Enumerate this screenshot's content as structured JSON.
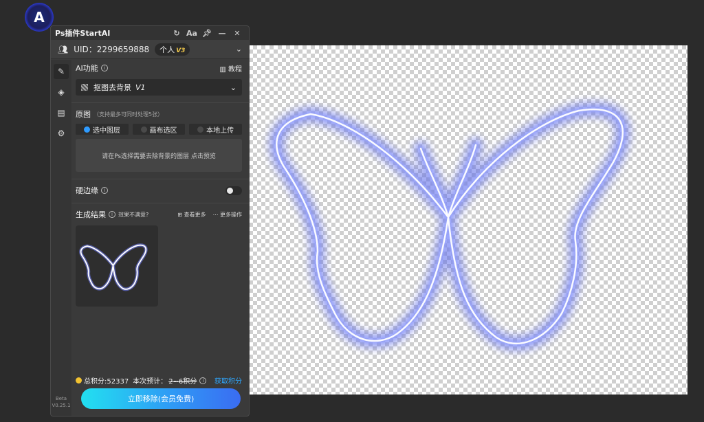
{
  "window": {
    "title": "Ps插件StartAI",
    "icons": [
      "refresh-icon",
      "font-size-icon",
      "pin-icon",
      "minimize-icon",
      "close-icon"
    ],
    "font_size_label": "Aa"
  },
  "user": {
    "uid": "UID：2299659888",
    "plan": "个人",
    "plan_version": "V3"
  },
  "sidebar": {
    "items": [
      "pen-icon",
      "layers-icon",
      "save-icon",
      "gear-icon"
    ],
    "beta": "Beta",
    "version": "V0.25.1"
  },
  "ai": {
    "label": "AI功能",
    "tutorial": "教程",
    "selected": "抠图去背景",
    "selected_version": "V1"
  },
  "source": {
    "label": "原图",
    "note": "（支持最多可同时处理5张）",
    "options": [
      "选中图层",
      "画布选区",
      "本地上传"
    ],
    "hint": "请在Ps选择需要去除背景的图层 点击预览"
  },
  "hard_edge": {
    "label": "硬边缘"
  },
  "result": {
    "label": "生成结果",
    "unsatisfied": "效果不满意?",
    "view_more": "查看更多",
    "more_ops": "更多操作"
  },
  "points": {
    "total": "总积分:52337",
    "estimate_prefix": "本次预计：",
    "estimate_value": "2~6积分",
    "get_points": "获取积分"
  },
  "cta": {
    "label": "立即移除(会员免费)"
  },
  "colors": {
    "accent": "#2fa7ff",
    "cta_start": "#22e0f0",
    "cta_end": "#3a6cf2",
    "glow": "#6f7cf5"
  }
}
